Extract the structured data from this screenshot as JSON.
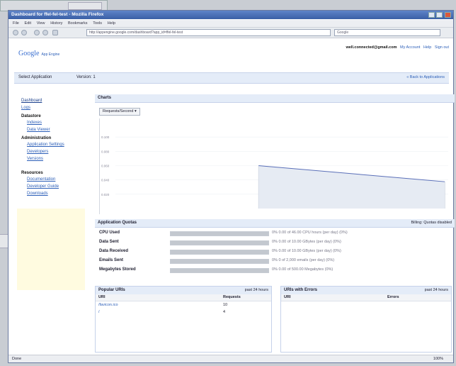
{
  "bg_window": {
    "title": ""
  },
  "window": {
    "title": "Dashboard for ffel-fel-test - Mozilla Firefox"
  },
  "menu": [
    "File",
    "Edit",
    "View",
    "History",
    "Bookmarks",
    "Tools",
    "Help"
  ],
  "nav": {
    "url": "http://appengine.google.com/dashboard?app_id=ffel-fel-test",
    "search_placeholder": "Google"
  },
  "header": {
    "logo": "Google",
    "logo_sub": "App Engine",
    "account_email": "well.connected@gmail.com",
    "account_links": [
      "My Account",
      "Help",
      "Sign out"
    ]
  },
  "appbar": {
    "app_selector": "Select Application",
    "version_label": "Version: 1",
    "right_link": "« Back to Applications"
  },
  "sidebar": {
    "top_links": [
      "Dashboard",
      "Logs"
    ],
    "sections": [
      {
        "title": "Datastore",
        "items": [
          "Indexes",
          "Data Viewer"
        ]
      },
      {
        "title": "Administration",
        "items": [
          "Application Settings",
          "Developers",
          "Versions"
        ]
      },
      {
        "title": "Resources",
        "items": [
          "Documentation",
          "Developer Guide",
          "Downloads"
        ]
      }
    ]
  },
  "charts": {
    "section_title": "Charts",
    "dropdown": "Requests/Second",
    "ytick_labels": [
      "0.100",
      "0.080",
      "0.060",
      "0.040",
      "0.020"
    ]
  },
  "chart_data": {
    "type": "area",
    "title": "",
    "xlabel": "",
    "ylabel": "",
    "ylim": [
      0,
      0.12
    ],
    "grid": true,
    "series": [
      {
        "values": [
          0.06,
          0.0375
        ],
        "x_fraction": [
          0.43,
          0.99
        ]
      }
    ]
  },
  "quotas": {
    "title": "Application Quotas",
    "right_label": "Billing: Quotas disabled",
    "rows": [
      {
        "name": "CPU Used",
        "fraction": 1.0,
        "detail": "0% 0.00 of 46.00 CPU hours (per day) (0%)"
      },
      {
        "name": "Data Sent",
        "fraction": 1.0,
        "detail": "0% 0.00 of 10.00 GBytes (per day) (0%)"
      },
      {
        "name": "Data Received",
        "fraction": 1.0,
        "detail": "0% 0.00 of 10.00 GBytes (per day) (0%)"
      },
      {
        "name": "Emails Sent",
        "fraction": 1.0,
        "detail": "0% 0 of 2,000 emails (per day) (0%)"
      },
      {
        "name": "Megabytes Stored",
        "fraction": 1.0,
        "detail": "0% 0.00 of 500.00 Megabytes (0%)"
      }
    ]
  },
  "popular": {
    "title": "Popular URIs",
    "right": "past 24 hours",
    "col1": "URI",
    "col2": "Requests",
    "rows": [
      {
        "uri": "/favicon.ico",
        "count": "10"
      },
      {
        "uri": "/",
        "count": "4"
      }
    ]
  },
  "errors": {
    "title": "URIs with Errors",
    "right": "past 24 hours",
    "col1": "URI",
    "col2": "Errors"
  },
  "status": {
    "text": "Done",
    "zoom": "100%"
  },
  "colors": {
    "accent": "#3a5fa6",
    "link": "#2c5fb8",
    "chart_line": "#5a6fb8",
    "chart_fill": "#e6ebf3"
  }
}
